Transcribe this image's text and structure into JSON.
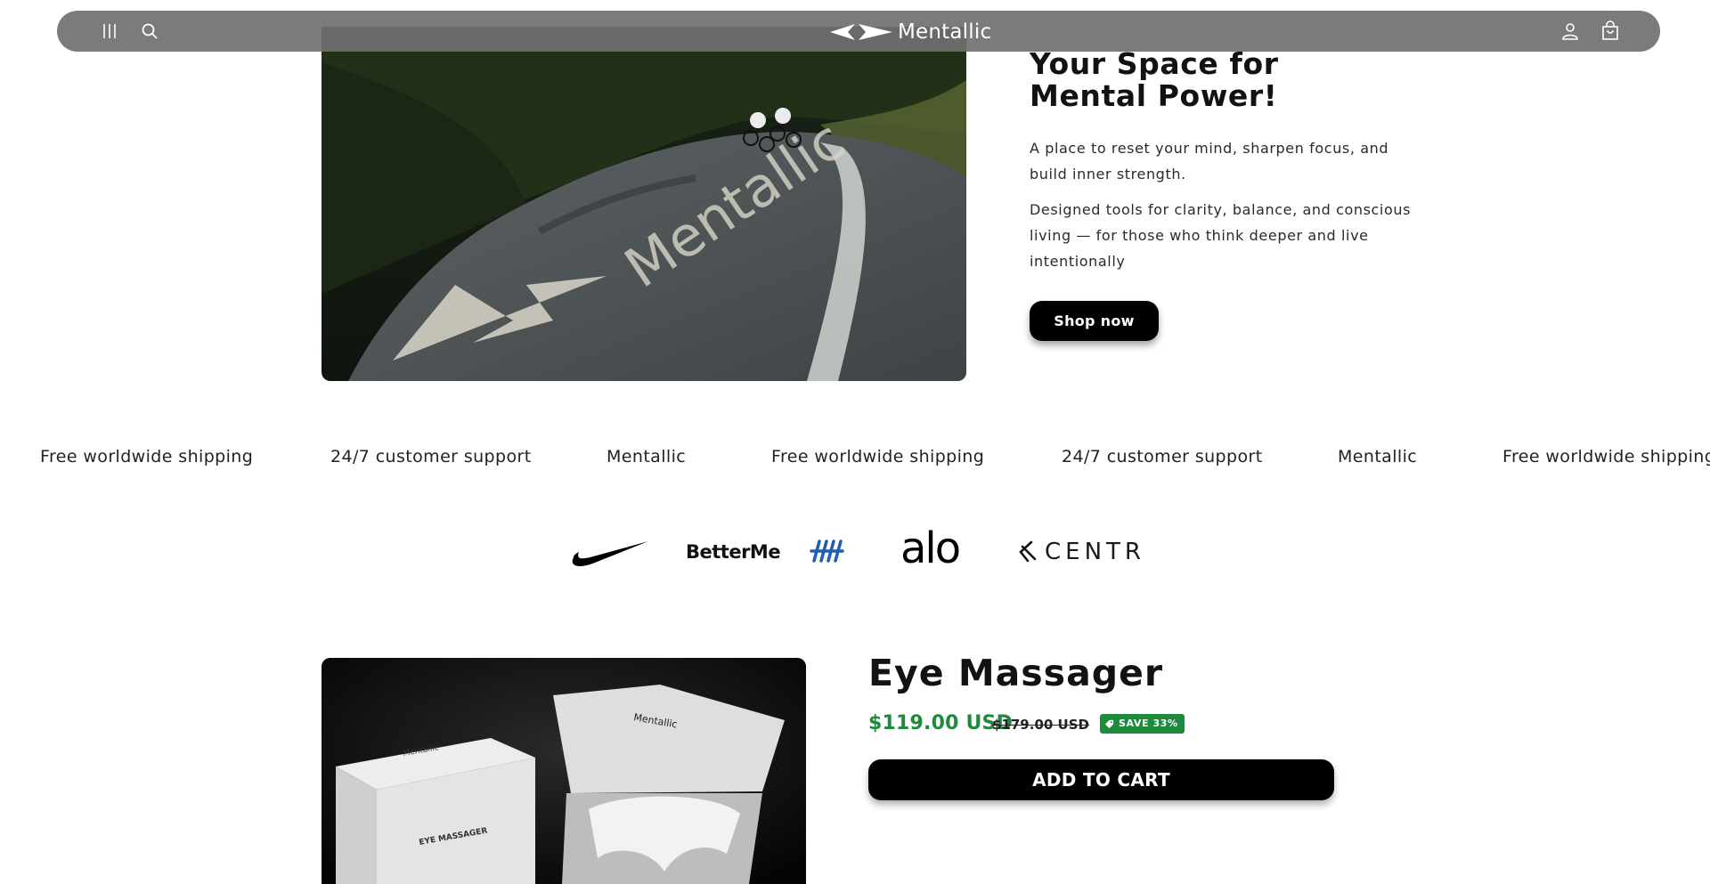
{
  "header": {
    "menu_icon": "menu-icon",
    "search_icon": "search-icon",
    "logo_text": "Mentallic",
    "account_icon": "account-icon",
    "cart_icon": "cart-icon"
  },
  "hero": {
    "image_road_text": "Mentallic",
    "title": "Your Space for Mental Power!",
    "paragraph1": "A place to reset your mind, sharpen focus, and build inner strength.",
    "paragraph2": "Designed tools for clarity, balance, and conscious living — for those who think deeper and live intentionally",
    "button_label": "Shop now"
  },
  "marquee": {
    "items": [
      "Free worldwide shipping",
      "24/7 customer support",
      "Mentallic",
      "Free worldwide shipping",
      "24/7 customer support",
      "Mentallic",
      "Free worldwide shipping"
    ]
  },
  "brands": {
    "logos": [
      "Nike",
      "BetterMe",
      "Hypervolt",
      "alo",
      "CENTR"
    ],
    "betterme_text": "BetterMe",
    "alo_text": "alo",
    "centr_text": "CENTR"
  },
  "product": {
    "title": "Eye Massager",
    "price": "$119.00 USD",
    "compare_price": "$179.00 USD",
    "badge": "SAVE 33%",
    "button_label": "ADD TO CART",
    "image_box_brand": "Mentallic",
    "image_box_label": "EYE MASSAGER"
  },
  "colors": {
    "header_bg": "#707070",
    "price_green": "#1e8a3c",
    "button_bg": "#000000",
    "text": "#121212"
  }
}
